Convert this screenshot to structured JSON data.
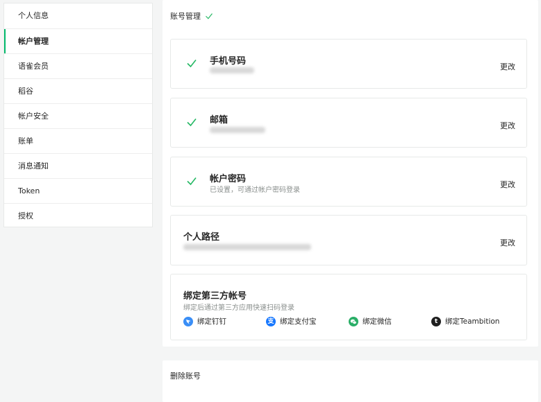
{
  "sidebar": {
    "items": [
      {
        "label": "个人信息",
        "active": false
      },
      {
        "label": "帐户管理",
        "active": true
      },
      {
        "label": "语雀会员",
        "active": false
      },
      {
        "label": "稻谷",
        "active": false
      },
      {
        "label": "帐户安全",
        "active": false
      },
      {
        "label": "账单",
        "active": false
      },
      {
        "label": "消息通知",
        "active": false
      },
      {
        "label": "Token",
        "active": false
      },
      {
        "label": "授权",
        "active": false
      }
    ]
  },
  "header": {
    "title": "账号管理"
  },
  "cards": {
    "phone": {
      "title": "手机号码",
      "action": "更改"
    },
    "email": {
      "title": "邮箱",
      "action": "更改"
    },
    "password": {
      "title": "帐户密码",
      "subtitle": "已设置，可通过帐户密码登录",
      "action": "更改"
    },
    "path": {
      "title": "个人路径",
      "action": "更改"
    }
  },
  "third_party": {
    "title": "绑定第三方帐号",
    "subtitle": "绑定后通过第三方应用快速扫码登录",
    "items": [
      {
        "label": "绑定钉钉",
        "icon": "dingtalk-icon",
        "color": "#3a8ef6"
      },
      {
        "label": "绑定支付宝",
        "icon": "alipay-icon",
        "color": "#1677ff"
      },
      {
        "label": "绑定微信",
        "icon": "wechat-icon",
        "color": "#2aae67"
      },
      {
        "label": "绑定Teambition",
        "icon": "teambition-icon",
        "color": "#1f1f1f"
      }
    ]
  },
  "delete": {
    "title": "删除账号"
  },
  "colors": {
    "accent": "#00b96b",
    "check": "#25b864"
  }
}
